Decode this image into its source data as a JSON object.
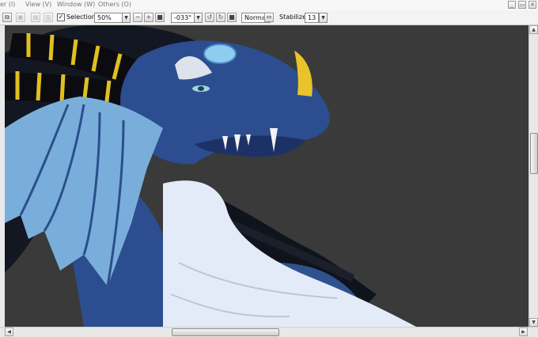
{
  "menubar": {
    "items": [
      "er (I)",
      "View (V)",
      "Window (W)",
      "Others (O)"
    ],
    "window_controls": [
      "_",
      "▭",
      "✕"
    ]
  },
  "toolbar": {
    "selection_checked": true,
    "selection_label": "Selection",
    "zoom_value": "50%",
    "rotation_value": "-033°",
    "blend_mode": "Normal",
    "stabilizer_label": "Stabilizer",
    "stabilizer_value": "13"
  },
  "canvas": {
    "background_color": "#3a3a3a"
  },
  "scrollbars": {
    "vertical": {
      "up_arrow": "▲",
      "down_arrow": "▼"
    },
    "horizontal": {
      "left_arrow": "◀",
      "right_arrow": "▶"
    }
  }
}
